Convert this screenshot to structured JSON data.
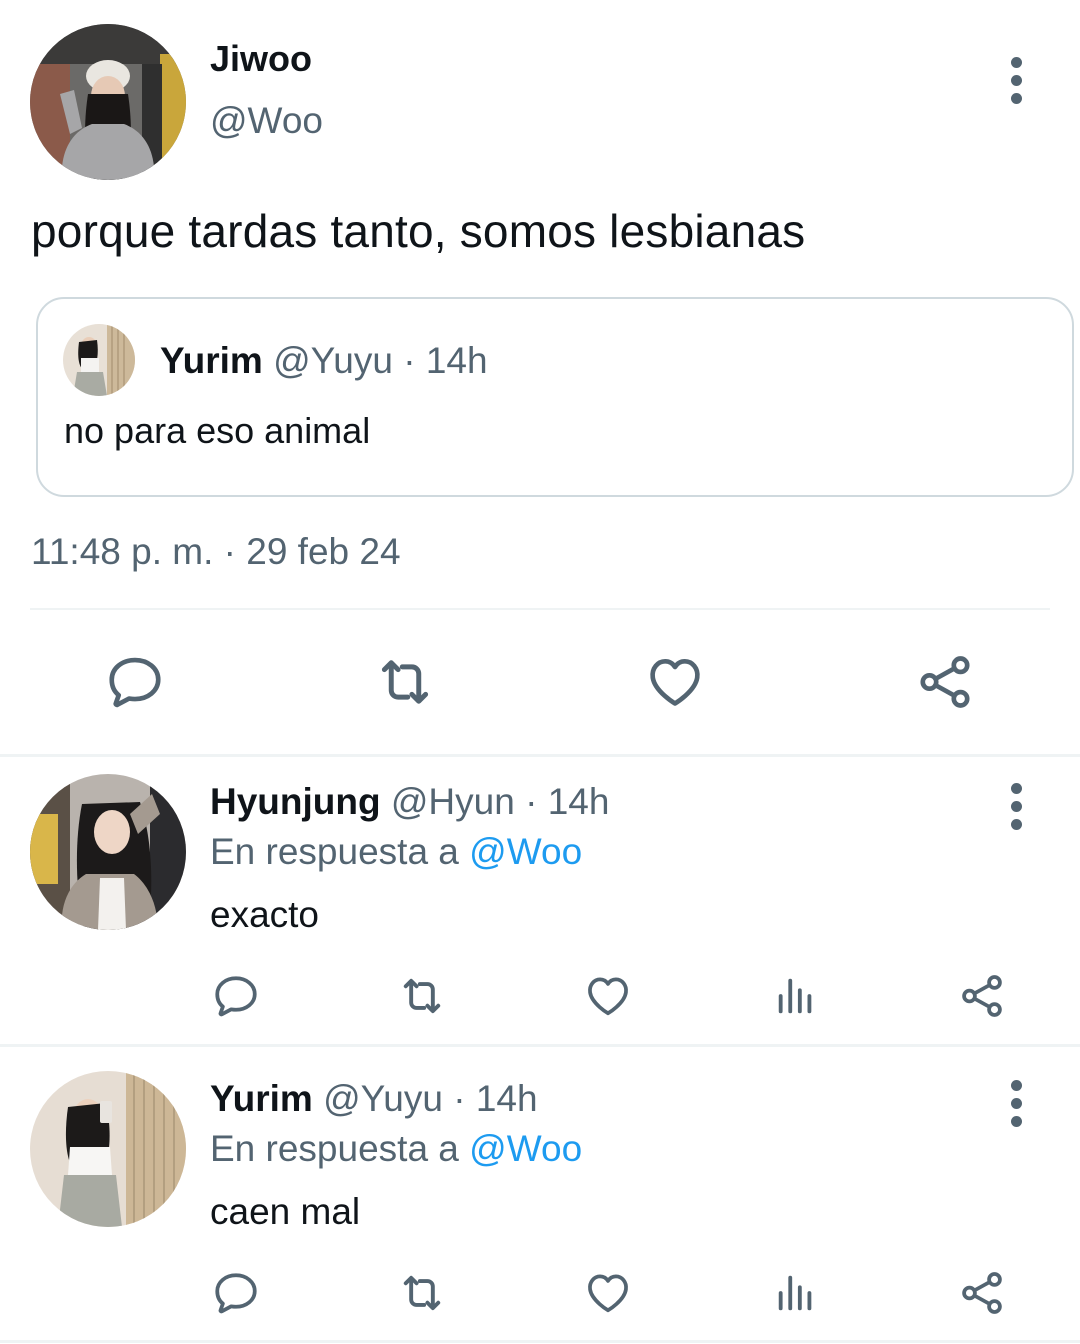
{
  "main_tweet": {
    "author_name": "Jiwoo",
    "author_handle": "@Woo",
    "text": "porque tardas tanto, somos lesbianas",
    "quoted": {
      "author_name": "Yurim",
      "meta": "@Yuyu · 14h",
      "text": "no para eso animal"
    },
    "timestamp": "11:48 p. m. · 29 feb 24",
    "actions": [
      "reply-icon",
      "retweet-icon",
      "like-icon",
      "share-icon"
    ]
  },
  "replies": [
    {
      "author_name": "Hyunjung",
      "meta": "@Hyun · 14h",
      "in_reply_prefix": "En respuesta a ",
      "in_reply_mention": "@Woo",
      "text": "exacto"
    },
    {
      "author_name": "Yurim",
      "meta": "@Yuyu · 14h",
      "in_reply_prefix": "En respuesta a ",
      "in_reply_mention": "@Woo",
      "text": "caen mal"
    }
  ],
  "reply_actions": [
    "reply-icon",
    "retweet-icon",
    "like-icon",
    "views-icon",
    "share-icon"
  ],
  "colors": {
    "text": "#0f1419",
    "secondary": "#536471",
    "accent": "#1d9bf0",
    "border": "#cfd9de",
    "divider": "#eff3f4"
  }
}
